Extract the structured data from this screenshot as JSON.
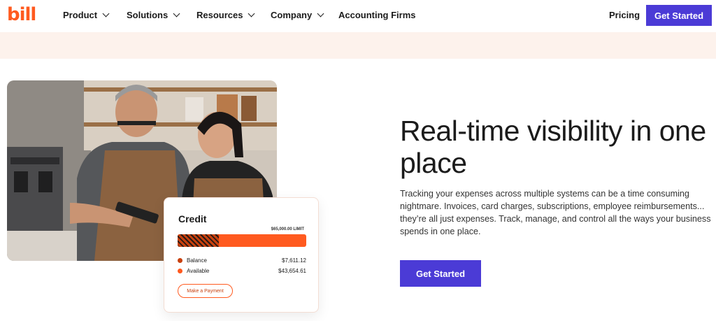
{
  "brand": {
    "logo_text": "bill",
    "accent": "#ff5a1f",
    "primary": "#4b3bd6"
  },
  "nav": {
    "items": [
      {
        "label": "Product",
        "has_dropdown": true
      },
      {
        "label": "Solutions",
        "has_dropdown": true
      },
      {
        "label": "Resources",
        "has_dropdown": true
      },
      {
        "label": "Company",
        "has_dropdown": true
      },
      {
        "label": "Accounting Firms",
        "has_dropdown": false
      }
    ],
    "pricing": "Pricing",
    "cta": "Get Started"
  },
  "hero": {
    "headline": "Real-time visibility in one place",
    "description": "Tracking your expenses across multiple systems can be a time consuming nightmare. Invoices, card charges, subscriptions, employee reimbursements... they’re all just expenses. Track, manage, and control all the ways your business spends in one place.",
    "cta": "Get Started"
  },
  "credit_card": {
    "title": "Credit",
    "limit": "$65,000.00 LIMIT",
    "used_fraction": 0.32,
    "rows": [
      {
        "label": "Balance",
        "value": "$7,611.12",
        "color": "#c8410f"
      },
      {
        "label": "Available",
        "value": "$43,654.61",
        "color": "#ff5a1f"
      }
    ],
    "action": "Make a Payment"
  }
}
